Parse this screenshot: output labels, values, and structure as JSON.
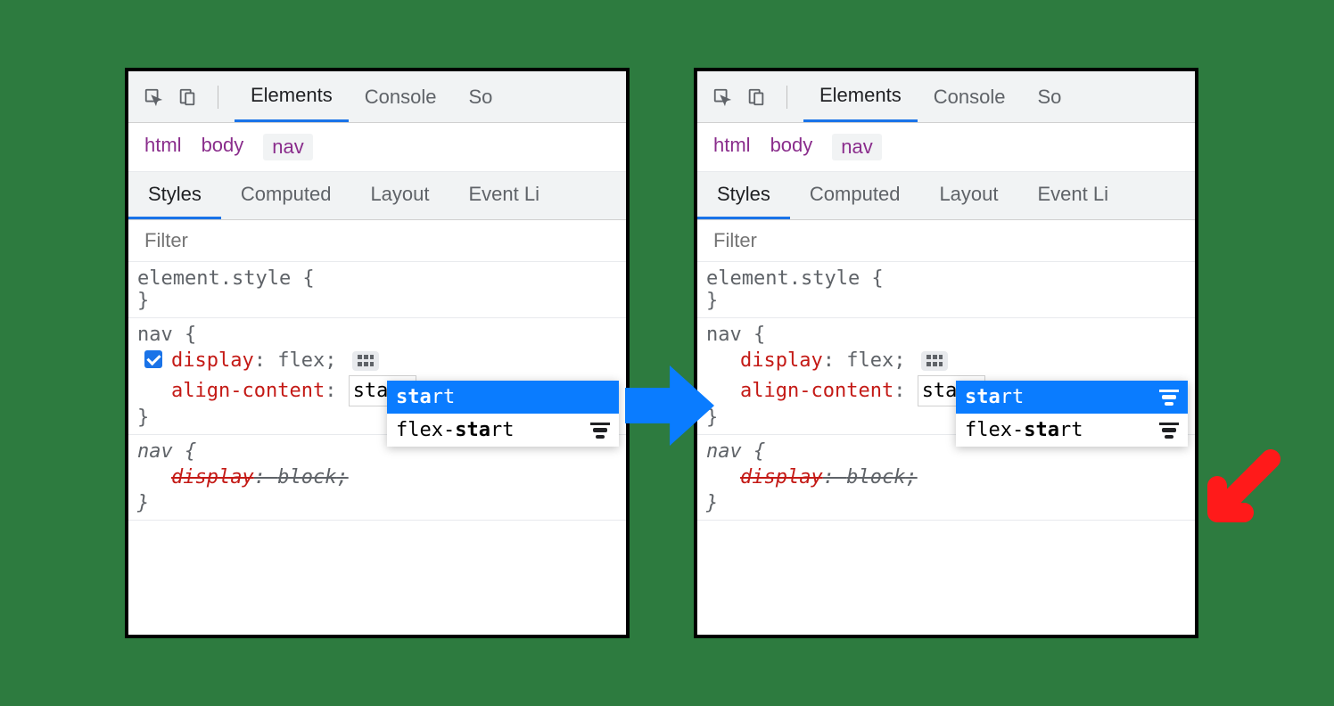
{
  "toolbar": {
    "tabs": [
      "Elements",
      "Console",
      "So"
    ]
  },
  "breadcrumb": [
    "html",
    "body",
    "nav"
  ],
  "subtabs": [
    "Styles",
    "Computed",
    "Layout",
    "Event Li"
  ],
  "filter_placeholder": "Filter",
  "rules": {
    "element_style": "element.style {",
    "element_style_close": "}",
    "nav_open": "nav {",
    "display_prop": "display",
    "display_val": "flex",
    "align_prop": "align-content",
    "align_val_typed": "sta",
    "align_val_suffix": "rt",
    "nav_close": "}",
    "ua_nav_open": "nav {",
    "ua_display_prop": "display",
    "ua_display_val": "block",
    "ua_nav_close": "}"
  },
  "autocomplete": {
    "option1_bold": "sta",
    "option1_rest": "rt",
    "option2_pre": "flex-",
    "option2_bold": "sta",
    "option2_rest": "rt"
  }
}
